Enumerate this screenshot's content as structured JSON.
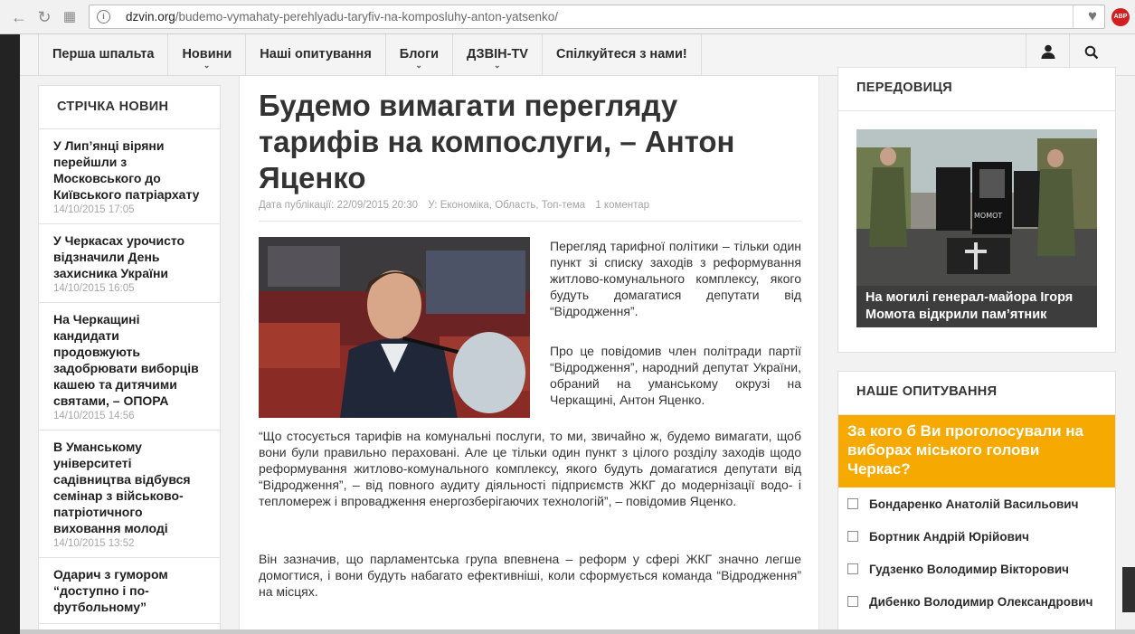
{
  "browser": {
    "url_host": "dzvin.org",
    "url_path": "/budemo-vymahaty-perehlyadu-taryfiv-na-komposluhy-anton-yatsenko/",
    "adblock_label": "ABP"
  },
  "nav": {
    "items": [
      {
        "label": "Перша шпальта",
        "has_dropdown": false
      },
      {
        "label": "Новини",
        "has_dropdown": true
      },
      {
        "label": "Наші опитування",
        "has_dropdown": false
      },
      {
        "label": "Блоги",
        "has_dropdown": true
      },
      {
        "label": "ДЗВІН-TV",
        "has_dropdown": true
      },
      {
        "label": "Спілкуйтеся з нами!",
        "has_dropdown": false
      }
    ],
    "user_icon": "user-icon",
    "search_icon": "search-icon"
  },
  "news_feed": {
    "heading": "СТРІЧКА НОВИН",
    "items": [
      {
        "title": "У Лип’янці віряни перейшли з Московського до Київського патріархату",
        "date": "14/10/2015 17:05"
      },
      {
        "title": "У Черкасах урочисто відзначили День захисника України",
        "date": "14/10/2015 16:05"
      },
      {
        "title": "На Черкащині кандидати продовжують задобрювати виборців кашею та дитячими святами, – ОПОРА",
        "date": "14/10/2015 14:56"
      },
      {
        "title": "В Уманському університеті садівництва відбувся семінар з військово-патріотичного виховання молоді",
        "date": "14/10/2015 13:52"
      },
      {
        "title": "Одарич з гумором “доступно і по-футбольному”",
        "date": ""
      }
    ]
  },
  "article": {
    "title": "Будемо вимагати перегляду тарифів на компослуги, – Антон Яценко",
    "meta_date": "Дата публікації: 22/09/2015 20:30",
    "meta_categories": "У: Економіка, Область, Топ-тема",
    "meta_comments": "1 коментар",
    "paragraphs": [
      "Перегляд тарифної політики – тільки один пункт зі списку заходів з реформування житлово-комунального комплексу, якого будуть домагатися депутати від “Відродження”.",
      "Про це повідомив член політради партії “Відродження”, народний депутат України, обраний на уманському окрузі на Черкащині, Антон Яценко.",
      "“Що стосується тарифів на комунальні послуги, то ми, звичайно ж, будемо вимагати, щоб вони були правильно пераховані. Але це тільки один пункт з цілого розділу заходів щодо реформування житлово-комунального комплексу, якого будуть домагатися депутати від “Відродження”, – від повного аудиту діяльності підприємств ЖКГ до модернізації водо- і тепломереж і впровадження енергозберігаючих технологій”, – повідомив Яценко.",
      "Він зазначив, що парламентська група впевнена – реформ у сфері ЖКГ значно легше домогтися, і вони будуть набагато ефективніші, коли сформується команда “Відродження” на місцях."
    ]
  },
  "editorial": {
    "heading": "ПЕРЕДОВИЦЯ",
    "caption": "На могилі генерал-майора Ігоря Момота відкрили пам’ятник",
    "plaque_text": "МОМОТ"
  },
  "poll": {
    "heading": "НАШЕ ОПИТУВАННЯ",
    "question": "За кого б Ви проголосували на виборах міського голови Черкас?",
    "options": [
      "Бондаренко Анатолій Васильович",
      "Бортник Андрій Юрійович",
      "Гудзенко Володимир Вікторович",
      "Дибенко Володимир Олександрович"
    ]
  },
  "colors": {
    "poll_accent": "#f6a900",
    "adblock_red": "#d21f1f",
    "caption_bg": "#3d3d3d"
  }
}
